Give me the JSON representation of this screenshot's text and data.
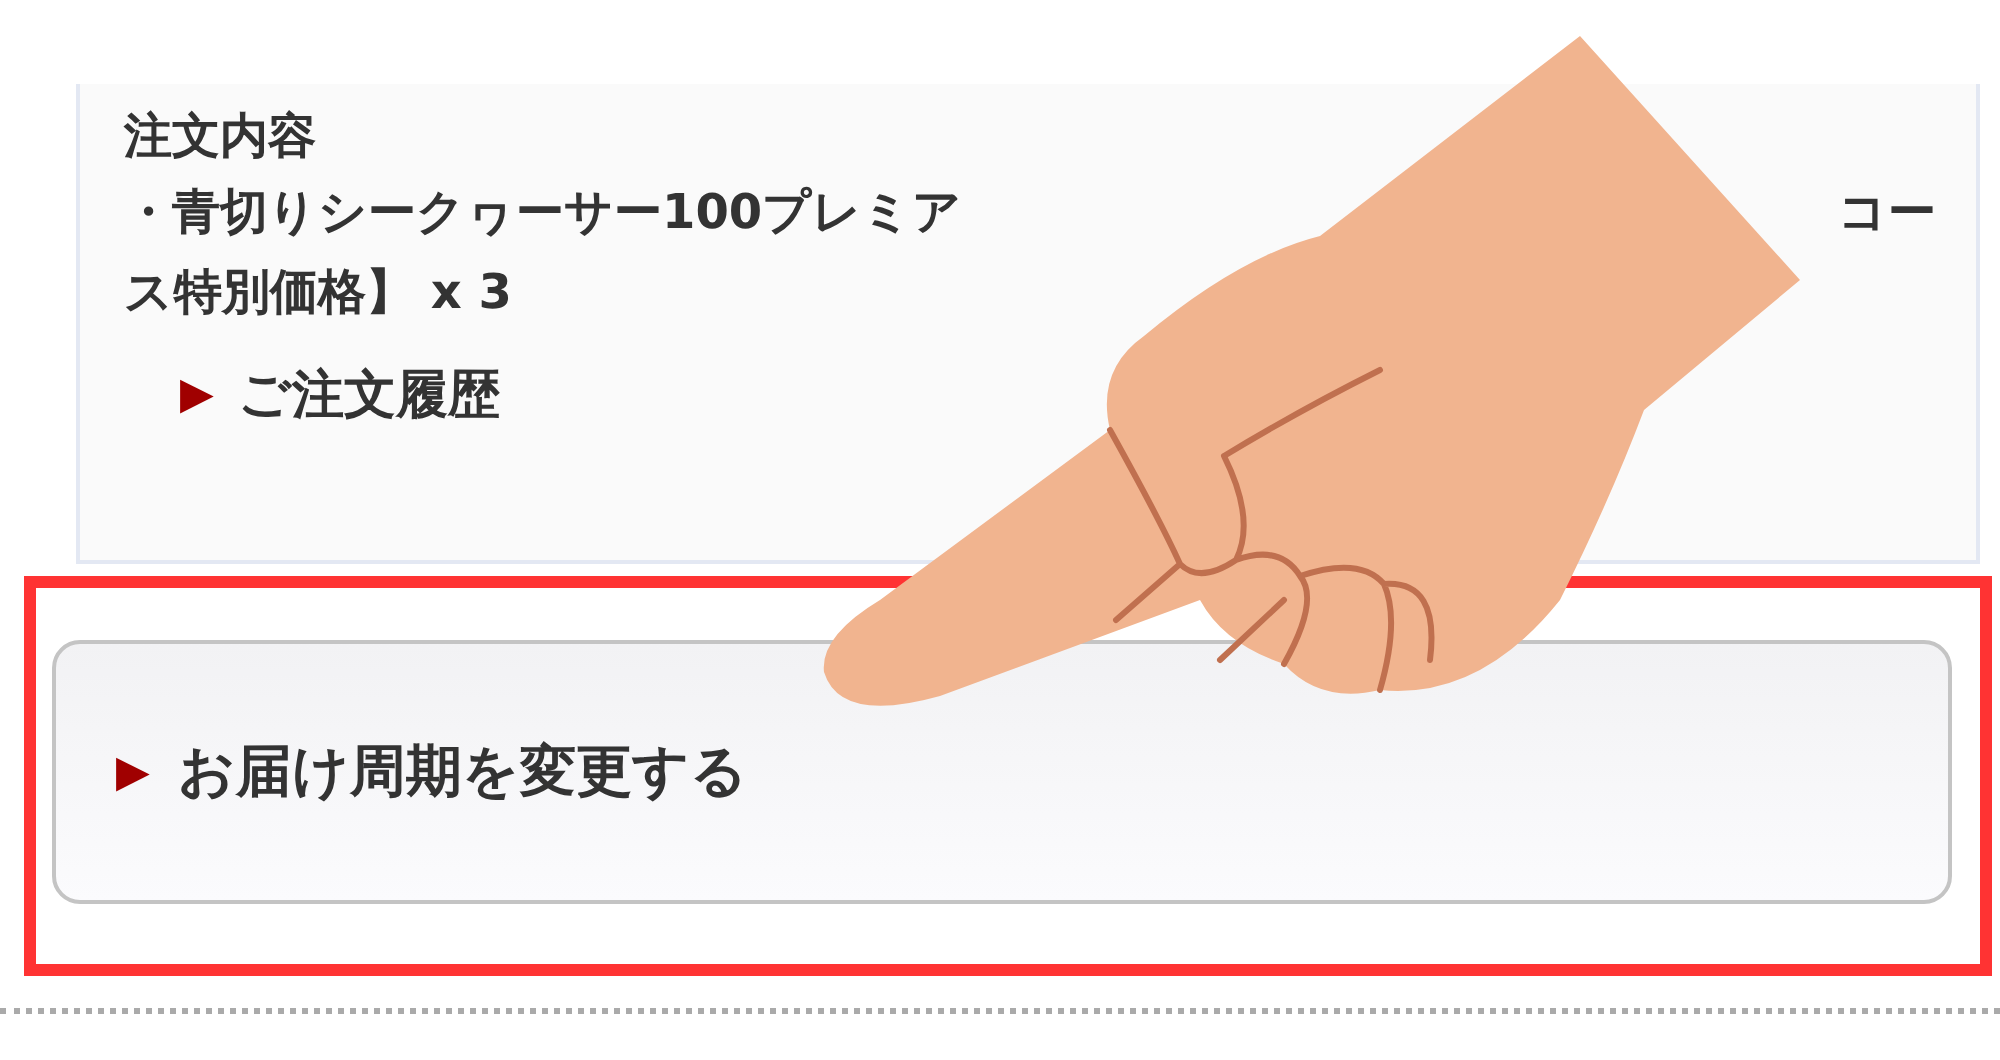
{
  "order_card": {
    "heading": "注文内容",
    "item_line_1_start": "・青切りシークヮーサー100プレミア",
    "item_line_1_end": "コー",
    "item_line_2": "ス特別価格】 x 3",
    "history_link": {
      "marker": "▶",
      "label": "ご注文履歴"
    }
  },
  "change_cycle_button": {
    "marker": "▶",
    "label": "お届け周期を変更する",
    "highlighted": true
  }
}
